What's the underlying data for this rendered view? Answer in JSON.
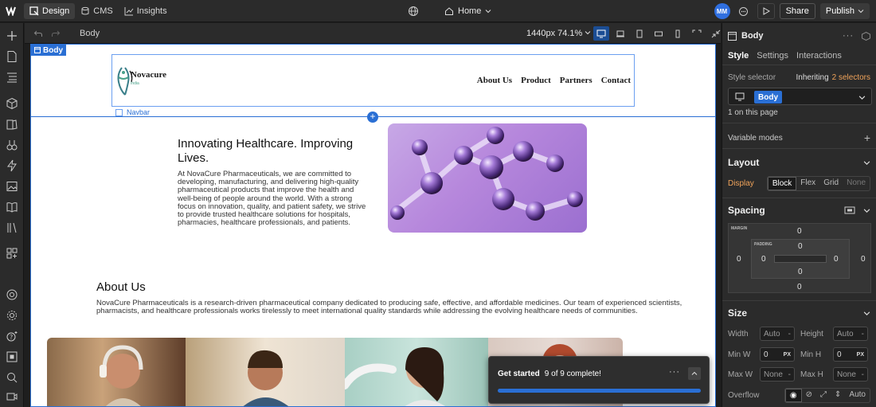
{
  "topbar": {
    "modes": [
      "Design",
      "CMS",
      "Insights"
    ],
    "page_name": "Home",
    "avatar_initials": "MM",
    "share_label": "Share",
    "publish_label": "Publish"
  },
  "canvas_toolbar": {
    "breadcrumb": "Body",
    "breakpoint": "1440px 74.1%"
  },
  "canvas": {
    "body_tag": "Body",
    "navbar_label": "Navbar",
    "logo": {
      "name": "Novacure",
      "sub": "India"
    },
    "nav_links": [
      "About Us",
      "Product",
      "Partners",
      "Contact"
    ],
    "hero": {
      "title": "Innovating Healthcare. Improving Lives.",
      "body": "At NovaCure Pharmaceuticals, we are committed to developing, manufacturing, and delivering high-quality pharmaceutical products that improve the health and well-being of people around the world. With a strong focus on innovation, quality, and patient safety, we strive to provide trusted healthcare solutions for hospitals, pharmacies, healthcare professionals, and patients."
    },
    "about": {
      "title": "About Us",
      "body": "NovaCure Pharmaceuticals is a research-driven pharmaceutical company dedicated to producing safe, effective, and affordable medicines. Our team of experienced scientists, pharmacists, and healthcare professionals works tirelessly to meet international quality standards while addressing the evolving healthcare needs of communities."
    }
  },
  "right_panel": {
    "element": "Body",
    "tabs": [
      "Style",
      "Settings",
      "Interactions"
    ],
    "style_selector_label": "Style selector",
    "inheriting_label": "Inheriting",
    "inheriting_count": "2 selectors",
    "selector_chip": "Body",
    "on_page": "1 on this page",
    "variable_modes": "Variable modes",
    "layout_heading": "Layout",
    "display_label": "Display",
    "display_options": [
      "Block",
      "Flex",
      "Grid",
      "None"
    ],
    "spacing_heading": "Spacing",
    "margin_label": "MARGIN",
    "padding_label": "PADDING",
    "margin": {
      "top": "0",
      "right": "0",
      "bottom": "0",
      "left": "0"
    },
    "padding": {
      "top": "0",
      "right": "0",
      "bottom": "0",
      "left": "0"
    },
    "size_heading": "Size",
    "width_label": "Width",
    "height_label": "Height",
    "width_value": "Auto",
    "height_value": "Auto",
    "min_w_label": "Min W",
    "min_h_label": "Min H",
    "min_w_value": "0",
    "min_h_value": "0",
    "unit_px": "PX",
    "max_w_label": "Max W",
    "max_h_label": "Max H",
    "max_w_value": "None",
    "max_h_value": "None",
    "overflow_label": "Overflow",
    "overflow_auto": "Auto"
  },
  "toast": {
    "title": "Get started",
    "progress_text": "9 of 9 complete!",
    "progress_fraction": 1.0
  },
  "colors": {
    "accent": "#2a6fd4",
    "display_label": "#f0a35a",
    "inheriting": "#f0a35a"
  }
}
